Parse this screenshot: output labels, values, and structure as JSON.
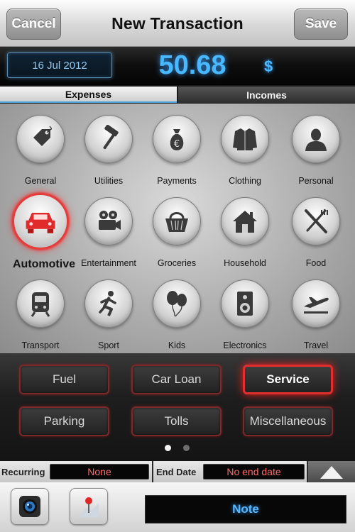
{
  "navbar": {
    "cancel_label": "Cancel",
    "title": "New Transaction",
    "save_label": "Save"
  },
  "display": {
    "date": "16 Jul 2012",
    "amount": "50.68",
    "currency": "$"
  },
  "tabs": [
    {
      "label": "Expenses",
      "selected": true
    },
    {
      "label": "Incomes",
      "selected": false
    }
  ],
  "categories": [
    {
      "label": "General",
      "icon": "tag-icon"
    },
    {
      "label": "Utilities",
      "icon": "hammer-icon"
    },
    {
      "label": "Payments",
      "icon": "money-bag-icon"
    },
    {
      "label": "Clothing",
      "icon": "jacket-icon"
    },
    {
      "label": "Personal",
      "icon": "person-icon"
    },
    {
      "label": "Automotive",
      "icon": "car-icon",
      "selected": true
    },
    {
      "label": "Entertainment",
      "icon": "film-camera-icon"
    },
    {
      "label": "Groceries",
      "icon": "basket-icon"
    },
    {
      "label": "Household",
      "icon": "house-icon"
    },
    {
      "label": "Food",
      "icon": "fork-knife-icon"
    },
    {
      "label": "Transport",
      "icon": "train-icon"
    },
    {
      "label": "Sport",
      "icon": "runner-icon"
    },
    {
      "label": "Kids",
      "icon": "balloons-icon"
    },
    {
      "label": "Electronics",
      "icon": "speaker-icon"
    },
    {
      "label": "Travel",
      "icon": "airplane-icon"
    }
  ],
  "subcategories": [
    {
      "label": "Fuel"
    },
    {
      "label": "Car Loan"
    },
    {
      "label": "Service",
      "selected": true
    },
    {
      "label": "Parking"
    },
    {
      "label": "Tolls"
    },
    {
      "label": "Miscellaneous"
    }
  ],
  "pager": {
    "pages": 2,
    "current": 1
  },
  "recurring": {
    "label": "Recurring",
    "value": "None",
    "end_label": "End Date",
    "end_value": "No end date"
  },
  "bottom": {
    "note_label": "Note",
    "camera_icon": "camera-icon",
    "location_icon": "location-pin-icon"
  },
  "colors": {
    "accent_blue": "#49b8ff",
    "selection_red": "#e42d2d",
    "value_red": "#ff6a6a"
  }
}
